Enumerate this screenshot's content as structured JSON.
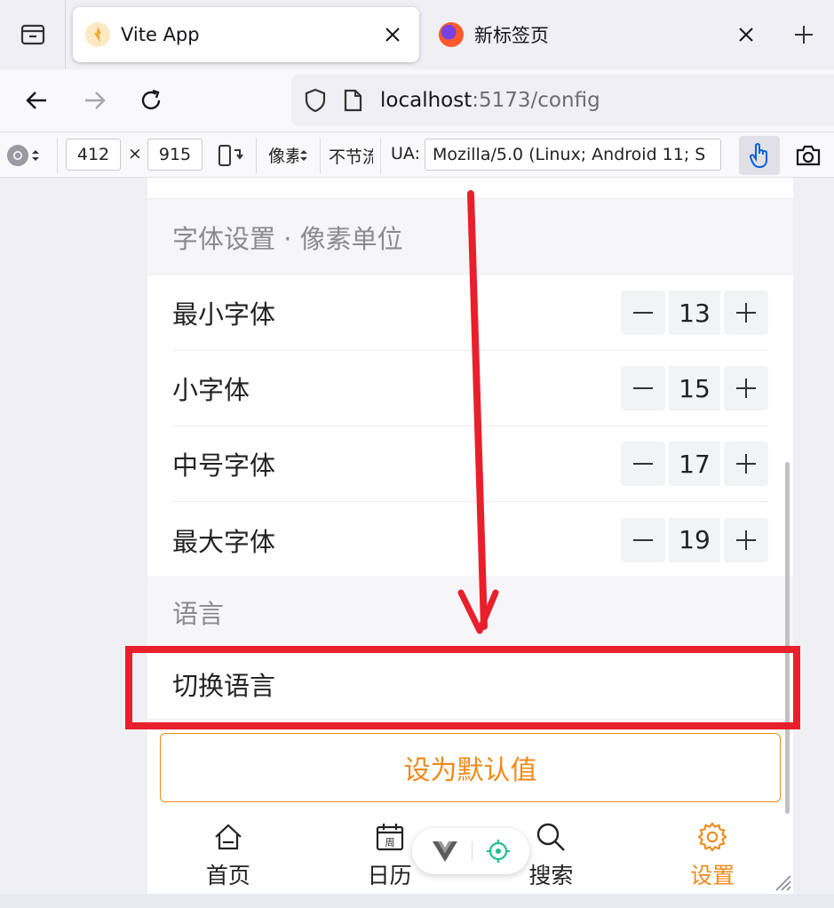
{
  "browser": {
    "tabs": [
      {
        "title": "Vite App",
        "active": true
      },
      {
        "title": "新标签页",
        "active": false
      }
    ],
    "url": {
      "host": "localhost",
      "rest": ":5173/config"
    }
  },
  "rdm": {
    "width": "412",
    "times": "×",
    "height": "915",
    "dpr_label": "像素",
    "throttle_label": "不节流",
    "ua_label": "UA:",
    "ua_value": "Mozilla/5.0 (Linux; Android 11; S"
  },
  "page": {
    "font_section": "字体设置 · 像素单位",
    "font_rows": [
      {
        "label": "最小字体",
        "value": "13"
      },
      {
        "label": "小字体",
        "value": "15"
      },
      {
        "label": "中号字体",
        "value": "17"
      },
      {
        "label": "最大字体",
        "value": "19"
      }
    ],
    "lang_section": "语言",
    "lang_row": "切换语言",
    "default_button": "设为默认值",
    "tabbar": [
      {
        "label": "首页",
        "icon": "home-icon",
        "active": false
      },
      {
        "label": "日历",
        "icon": "calendar-icon",
        "active": false,
        "icon_text": "周"
      },
      {
        "label": "搜索",
        "icon": "search-icon",
        "active": false
      },
      {
        "label": "设置",
        "icon": "gear-icon",
        "active": true
      }
    ]
  },
  "colors": {
    "accent": "#ee8a1a",
    "annotation": "#e8202c"
  }
}
